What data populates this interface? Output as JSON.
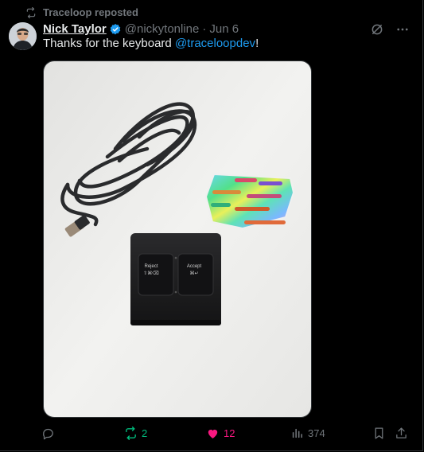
{
  "repost_banner": {
    "text": "Traceloop reposted"
  },
  "tweet": {
    "author_name": "Nick Taylor",
    "handle": "@nickytonline",
    "separator": "·",
    "date": "Jun 6",
    "text_before": "Thanks for the keyboard ",
    "mention": "@traceloopdev",
    "text_after": "!"
  },
  "media": {
    "keycaps": [
      {
        "label": "Reject",
        "symbols": "⇧⌘⌫"
      },
      {
        "label": "Accept",
        "symbols": "⌘↵"
      }
    ]
  },
  "actions": {
    "replies": "",
    "retweets": "2",
    "likes": "12",
    "views": "374"
  },
  "colors": {
    "background": "#000000",
    "text": "#e7e9ea",
    "muted": "#71767b",
    "link": "#1d9bf0",
    "retweet_active": "#00ba7c",
    "like_active": "#f91880",
    "verified_badge": "#1d9bf0"
  },
  "icons": {
    "repost_banner": "retweet-icon",
    "verified": "verified-badge-icon",
    "grok": "grok-icon",
    "more": "more-icon",
    "reply": "reply-icon",
    "retweet": "retweet-icon",
    "like": "heart-icon",
    "views": "views-icon",
    "bookmark": "bookmark-icon",
    "share": "share-icon"
  }
}
